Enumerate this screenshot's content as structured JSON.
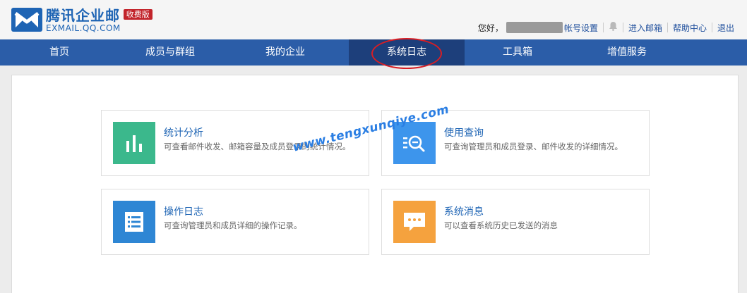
{
  "header": {
    "logo_cn": "腾讯企业邮",
    "logo_en": "EXMAIL.QQ.COM",
    "badge": "收费版",
    "greeting": "您好，",
    "links": {
      "account": "帐号设置",
      "inbox": "进入邮箱",
      "help": "帮助中心",
      "logout": "退出"
    }
  },
  "nav": {
    "items": [
      {
        "label": "首页"
      },
      {
        "label": "成员与群组"
      },
      {
        "label": "我的企业"
      },
      {
        "label": "系统日志"
      },
      {
        "label": "工具箱"
      },
      {
        "label": "增值服务"
      }
    ],
    "active_index": 3
  },
  "cards": [
    {
      "title": "统计分析",
      "desc": "可查看邮件收发、邮箱容量及成员登录的统计情况。",
      "icon": "bar-chart-icon",
      "color": "#3bb88c"
    },
    {
      "title": "使用查询",
      "desc": "可查询管理员和成员登录、邮件收发的详细情况。",
      "icon": "search-list-icon",
      "color": "#3d95ec"
    },
    {
      "title": "操作日志",
      "desc": "可查询管理员和成员详细的操作记录。",
      "icon": "list-icon",
      "color": "#2e86d4"
    },
    {
      "title": "系统消息",
      "desc": "可以查看系统历史已发送的消息",
      "icon": "message-icon",
      "color": "#f5a23e"
    }
  ],
  "watermark": "www.tengxunqiye.com"
}
